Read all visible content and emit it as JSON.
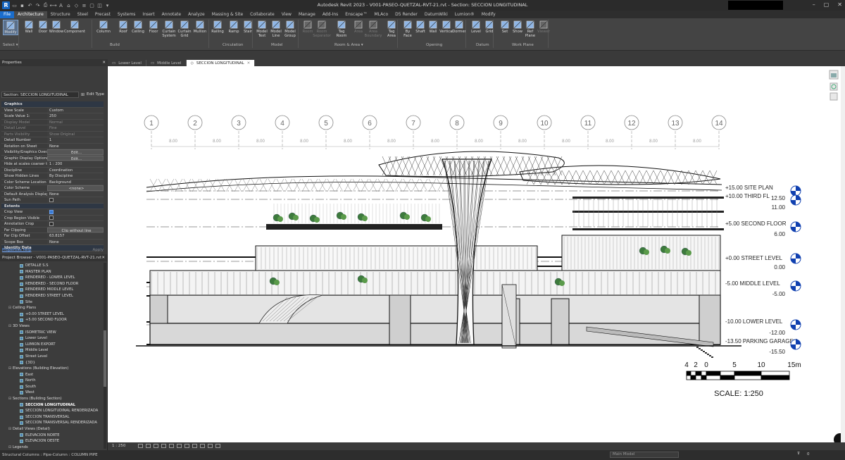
{
  "window": {
    "title": "Autodesk Revit 2023 - V001-PASEO-QUETZAL-RVT-21.rvt - Section: SECCION LONGITUDINAL"
  },
  "menu_tabs": [
    "File",
    "Architecture",
    "Structure",
    "Steel",
    "Precast",
    "Systems",
    "Insert",
    "Annotate",
    "Analyze",
    "Massing & Site",
    "Collaborate",
    "View",
    "Manage",
    "Add-Ins",
    "Enscape™",
    "MLAco",
    "D5 Render",
    "DatumWiki",
    "Lumion®",
    "Modify"
  ],
  "ribbon": {
    "buttons": [
      "Modify",
      "Wall",
      "Door",
      "Window",
      "Component",
      "Column",
      "Roof",
      "Ceiling",
      "Floor",
      "Curtain System",
      "Curtain Grid",
      "Mullion",
      "Railing",
      "Ramp",
      "Stair",
      "Model Text",
      "Model Line",
      "Model Group",
      "Room",
      "Room Separator",
      "Tag Room",
      "Area",
      "Area Boundary",
      "Tag Area",
      "By Face",
      "Shaft",
      "Wall",
      "Vertical",
      "Dormer",
      "Level",
      "Grid",
      "Set",
      "Show",
      "Ref Plane",
      "Viewer"
    ],
    "panels": [
      "Select ▾",
      "Build",
      "Circulation",
      "Model",
      "Room & Area ▾",
      "Opening",
      "Datum",
      "Work Plane"
    ]
  },
  "properties": {
    "title": "Properties",
    "type_selector": "Section: SECCION LONGITUDINAL",
    "edit_type": "Edit Type",
    "rows": [
      {
        "k": "Graphics",
        "group": true
      },
      {
        "k": "View Scale",
        "v": "Custom"
      },
      {
        "k": "Scale Value  1:",
        "v": "250"
      },
      {
        "k": "Display Model",
        "v": "Normal",
        "dim": true
      },
      {
        "k": "Detail Level",
        "v": "Fine",
        "dim": true
      },
      {
        "k": "Parts Visibility",
        "v": "Show Original",
        "dim": true
      },
      {
        "k": "Detail Number",
        "v": "1"
      },
      {
        "k": "Rotation on Sheet",
        "v": "None"
      },
      {
        "k": "Visibility/Graphics Over...",
        "v": "Edit...",
        "btn": true
      },
      {
        "k": "Graphic Display Options",
        "v": "Edit...",
        "btn": true
      },
      {
        "k": "Hide at scales coarser t...",
        "v": "1 : 200"
      },
      {
        "k": "Discipline",
        "v": "Coordination"
      },
      {
        "k": "Show Hidden Lines",
        "v": "By Discipline"
      },
      {
        "k": "Color Scheme Location",
        "v": "Background"
      },
      {
        "k": "Color Scheme",
        "v": "<none>",
        "btn": true
      },
      {
        "k": "Default Analysis Display...",
        "v": "None"
      },
      {
        "k": "Sun Path",
        "chk": false
      },
      {
        "k": "Extents",
        "group": true
      },
      {
        "k": "Crop View",
        "chk": true
      },
      {
        "k": "Crop Region Visible",
        "chk": false
      },
      {
        "k": "Annotation Crop",
        "chk": false
      },
      {
        "k": "Far Clipping",
        "v": "Clip without line",
        "btn": true
      },
      {
        "k": "Far Clip Offset",
        "v": "63.8157"
      },
      {
        "k": "Scope Box",
        "v": "None"
      },
      {
        "k": "Identity Data",
        "group": true
      }
    ],
    "help": "Properties help",
    "apply": "Apply"
  },
  "browser": {
    "title": "Project Browser - V001-PASEO-QUETZAL-RVT-21.rvt",
    "nodes": [
      {
        "t": "DETALLE S.S",
        "lvl": 3
      },
      {
        "t": "MASTER PLAN",
        "lvl": 3
      },
      {
        "t": "RENDERED - LOWER LEVEL",
        "lvl": 3
      },
      {
        "t": "RENDERED - SECOND FLOOR",
        "lvl": 3
      },
      {
        "t": "RENDERED MIDDLE LEVEL",
        "lvl": 3
      },
      {
        "t": "RENDERED STREET LEVEL",
        "lvl": 3
      },
      {
        "t": "Site",
        "lvl": 3
      },
      {
        "t": "Ceiling Plans",
        "lvl": 1
      },
      {
        "t": "+0.00 STREET LEVEL",
        "lvl": 3
      },
      {
        "t": "+5.00 SECOND FLOOR",
        "lvl": 3
      },
      {
        "t": "3D Views",
        "lvl": 1
      },
      {
        "t": "ISOMETRIC VIEW",
        "lvl": 3
      },
      {
        "t": "Lower Level",
        "lvl": 3
      },
      {
        "t": "LUMION EXPORT",
        "lvl": 3
      },
      {
        "t": "Middle Level",
        "lvl": 3
      },
      {
        "t": "Street Level",
        "lvl": 3
      },
      {
        "t": "{3D}",
        "lvl": 3
      },
      {
        "t": "Elevations (Building Elevation)",
        "lvl": 1
      },
      {
        "t": "East",
        "lvl": 3
      },
      {
        "t": "North",
        "lvl": 3
      },
      {
        "t": "South",
        "lvl": 3
      },
      {
        "t": "West",
        "lvl": 3
      },
      {
        "t": "Sections (Building Section)",
        "lvl": 1
      },
      {
        "t": "SECCION LONGITUDINAL",
        "lvl": 3,
        "bold": true
      },
      {
        "t": "SECCION LONGITUDINAL RENDERIZADA",
        "lvl": 3
      },
      {
        "t": "SECCION TRANSVERSAL",
        "lvl": 3
      },
      {
        "t": "SECCION TRANSVERSAL RENDERIZADA",
        "lvl": 3
      },
      {
        "t": "Detail Views (Detail)",
        "lvl": 1
      },
      {
        "t": "ELEVACION NORTE",
        "lvl": 3
      },
      {
        "t": "ELEVACION OESTE",
        "lvl": 3
      },
      {
        "t": "Legends",
        "lvl": 1
      }
    ]
  },
  "view_tabs": [
    "Lower Level",
    "Middle Level",
    "SECCION LONGITUDINAL"
  ],
  "drawing": {
    "grids": [
      "1",
      "2",
      "3",
      "4",
      "5",
      "6",
      "7",
      "8",
      "9",
      "10",
      "11",
      "12",
      "13",
      "14"
    ],
    "grid_dim": "8.00",
    "levels": [
      {
        "name": "+15.00 SITE PLAN"
      },
      {
        "name": "+10.00 THIRD FL",
        "elev": "12.50"
      },
      {
        "name": "",
        "elev": "11.00"
      },
      {
        "name": "+5.00 SECOND FLOOR",
        "elev": "6.00"
      },
      {
        "name": "+0.00 STREET LEVEL",
        "elev": "0.00"
      },
      {
        "name": "-5.00 MIDDLE LEVEL",
        "elev": "-5.00"
      },
      {
        "name": "-10.00 LOWER LEVEL",
        "elev": "-12.00"
      },
      {
        "name": "-13.50 PARKING GARAGE 1",
        "elev": "-15.50"
      }
    ],
    "scale_ticks": [
      "4",
      "2",
      "0",
      "5",
      "10",
      "15m"
    ],
    "scale_text": "SCALE: 1:250"
  },
  "view_bar": {
    "scale": "1 : 250"
  },
  "status": {
    "text": "Structural Columns : Pipe-Column : COLUMN PIPE",
    "model": "Main Model",
    "count": "0"
  }
}
